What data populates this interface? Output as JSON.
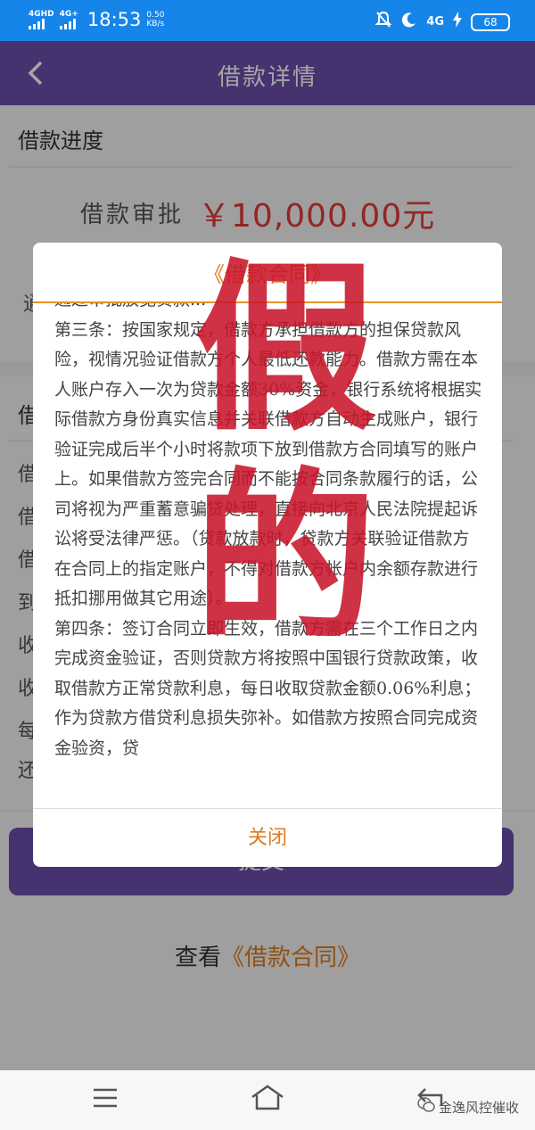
{
  "status_bar": {
    "sim1_label": "4GHD",
    "sim2_label": "4G+",
    "time": "18:53",
    "speed_value": "0.50",
    "speed_unit": "KB/s",
    "network_label": "4G",
    "battery": "68",
    "accent": "#1685e9"
  },
  "navbar": {
    "title": "借款详情",
    "back_icon": "chevron-left-icon",
    "color": "#6a4eab"
  },
  "page": {
    "progress_title": "借款进度",
    "approve_label": "借款审批",
    "approve_amount": "￥10,000.00元",
    "row_char": "通",
    "details_title_char": "借",
    "detail_row_chars": [
      "借",
      "借",
      "借",
      "到",
      "收",
      "收",
      "每",
      "还"
    ],
    "submit_label": "提交",
    "view_prefix": "查看",
    "view_link": "《借款合同》",
    "amount_color": "#e43b3b",
    "link_color": "#e07a1c"
  },
  "modal": {
    "title": "《借款合同》",
    "partial_top_line": "通过审批放宽贷款...",
    "paragraphs": [
      "第三条：按国家规定，借款方承担借款方的担保贷款风险，视情况验证借款方个人最低还款能力。借款方需在本人账户存入一次为贷款金额30%资金，银行系统将根据实际借款方身份真实信息并关联借款方自动生成账户，银行验证完成后半个小时将款项下放到借款方合同填写的账户上。如果借款方签完合同而不能按合同条款履行的话，公司将视为严重蓄意骗贷处理，直接向北京人民法院提起诉讼将受法律严惩。（贷款放款时，贷款方关联验证借款方在合同上的指定账户，不得对借款方帐户内余额存款进行抵扣挪用做其它用途）。",
      "第四条：签订合同立即生效，借款方需在三个工作日之内完成资金验证，否则贷款方将按照中国银行贷款政策，收取借款方正常贷款利息，每日收取贷款金额0.06%利息；作为贷款方借贷利息损失弥补。如借款方按照合同完成资金验资，贷"
    ],
    "close_label": "关闭",
    "accent": "#e07a1c"
  },
  "stamp": {
    "line1": "假",
    "line2": "的",
    "color": "#c8162a"
  },
  "watermark": {
    "text": "金逸风控催收",
    "icon": "wechat-icon"
  },
  "bottom_nav": {
    "menu_icon": "menu-icon",
    "home_icon": "home-icon",
    "back_icon": "back-arrow-icon"
  }
}
